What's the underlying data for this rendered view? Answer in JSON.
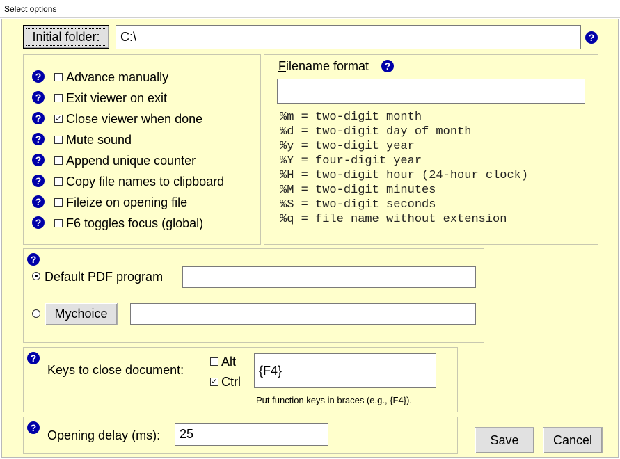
{
  "window": {
    "title": "Select options"
  },
  "initial_folder": {
    "button_pre": "",
    "button_u": "I",
    "button_post": "nitial folder:",
    "value": "C:\\"
  },
  "options": [
    {
      "label": "Advance manually",
      "checked": false
    },
    {
      "label": "Exit viewer on exit",
      "checked": false
    },
    {
      "label": "Close viewer when done",
      "checked": true
    },
    {
      "label": "Mute sound",
      "checked": false
    },
    {
      "label": "Append unique counter",
      "checked": false
    },
    {
      "label": "Copy file names to clipboard",
      "checked": false
    },
    {
      "label": "Fileize on opening file",
      "checked": false
    },
    {
      "label": "F6 toggles focus (global)",
      "checked": false
    }
  ],
  "filename_format": {
    "title_u": "F",
    "title_rest": "ilename format",
    "value": "",
    "codes": [
      "%m = two-digit month",
      "%d = two-digit day of month",
      "%y = two-digit year",
      "%Y = four-digit year",
      "%H = two-digit hour (24-hour clock)",
      "%M = two-digit minutes",
      "%S = two-digit seconds",
      "%q = file name without extension"
    ]
  },
  "pdf": {
    "default_u": "D",
    "default_rest": "efault PDF program",
    "default_selected": true,
    "default_value": "",
    "mychoice_pre": "My ",
    "mychoice_u": "c",
    "mychoice_post": "hoice",
    "mychoice_value": ""
  },
  "keys": {
    "label": "Keys to close document:",
    "alt_u": "A",
    "alt_rest": "lt",
    "alt_checked": false,
    "ctrl_pre": "C",
    "ctrl_u": "t",
    "ctrl_post": "rl",
    "ctrl_checked": true,
    "value": "{F4}",
    "hint": "Put function keys in braces (e.g., {F4})."
  },
  "delay": {
    "label": "Opening delay (ms):",
    "value": "25"
  },
  "buttons": {
    "save": "Save",
    "cancel": "Cancel"
  },
  "icons": {
    "help": "help-icon",
    "help_glyph": "?",
    "check_glyph": "✓"
  },
  "colors": {
    "background": "#ffffcc",
    "help_icon": "#0000a8"
  }
}
